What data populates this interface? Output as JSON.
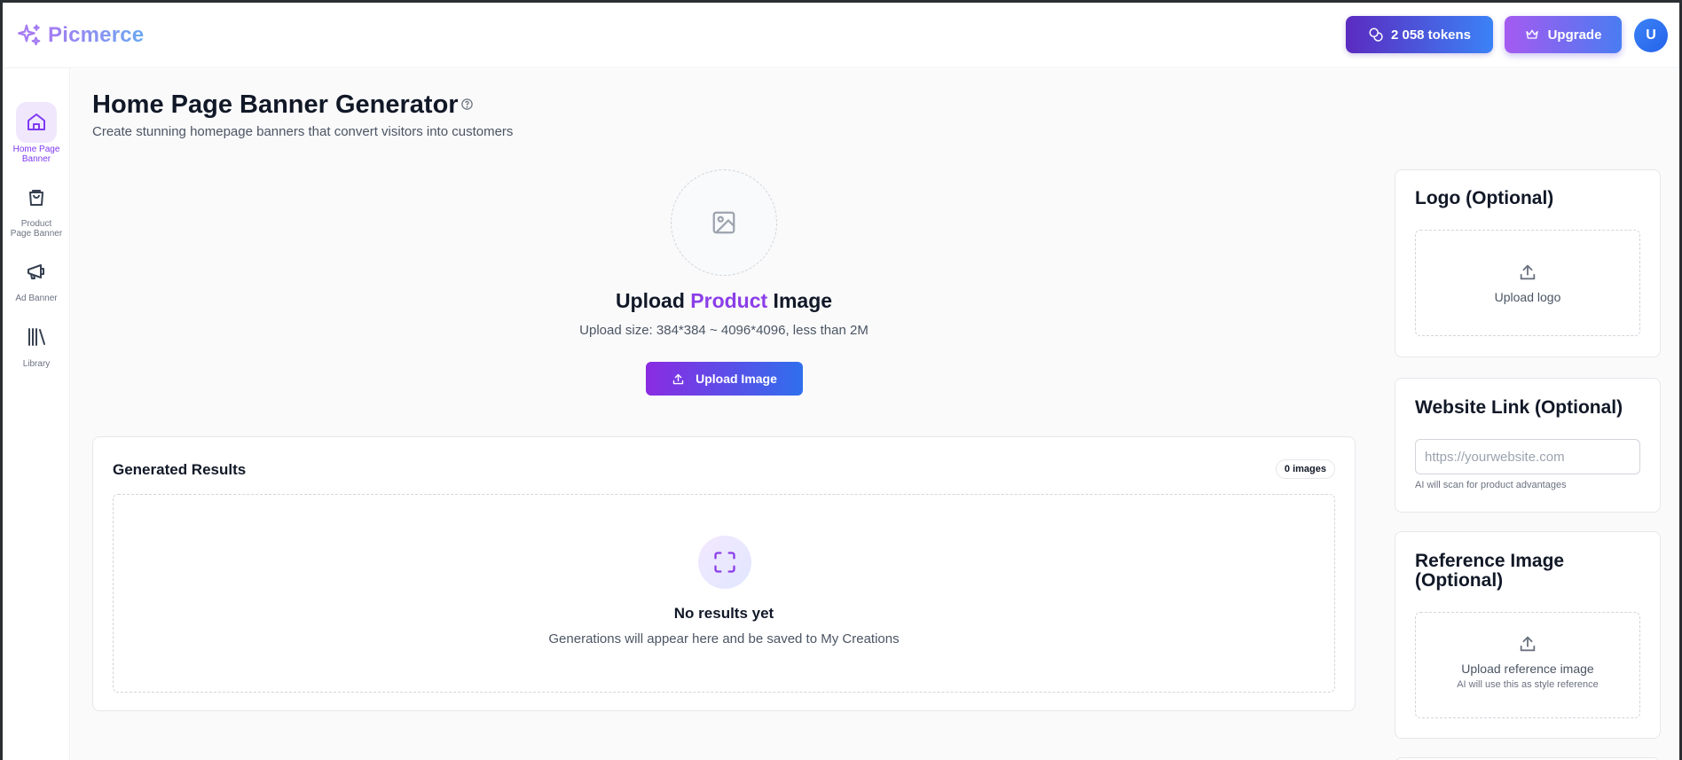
{
  "header": {
    "brand": "Picmerce",
    "tokens_label": "2 058 tokens",
    "upgrade_label": "Upgrade",
    "avatar_initial": "U"
  },
  "sidebar": {
    "items": [
      {
        "label": "Home Page Banner",
        "icon": "home-icon",
        "active": true
      },
      {
        "label": "Product Page Banner",
        "icon": "shopping-bag-icon",
        "active": false
      },
      {
        "label": "Ad Banner",
        "icon": "megaphone-icon",
        "active": false
      },
      {
        "label": "Library",
        "icon": "library-icon",
        "active": false
      }
    ]
  },
  "main": {
    "title": "Home Page Banner Generator",
    "subtitle": "Create stunning homepage banners that convert visitors into customers",
    "upload": {
      "title_prefix": "Upload ",
      "title_accent": "Product",
      "title_suffix": " Image",
      "hint": "Upload size: 384*384 ~ 4096*4096, less than 2M",
      "button_label": "Upload Image"
    },
    "results": {
      "title": "Generated Results",
      "count_badge": "0 images",
      "empty_title": "No results yet",
      "empty_subtitle": "Generations will appear here and be saved to My Creations"
    }
  },
  "panels": {
    "logo": {
      "title": "Logo (Optional)",
      "upload_label": "Upload logo"
    },
    "website": {
      "title": "Website Link (Optional)",
      "placeholder": "https://yourwebsite.com",
      "value": "",
      "note": "AI will scan for product advantages"
    },
    "reference": {
      "title": "Reference Image (Optional)",
      "upload_label": "Upload reference image",
      "upload_sub": "AI will use this as style reference"
    }
  },
  "colors": {
    "accent_purple": "#8b3ee8",
    "accent_blue": "#3b82f6",
    "brand_gradient_start": "#a57cf3",
    "brand_gradient_end": "#6aa8f0"
  }
}
